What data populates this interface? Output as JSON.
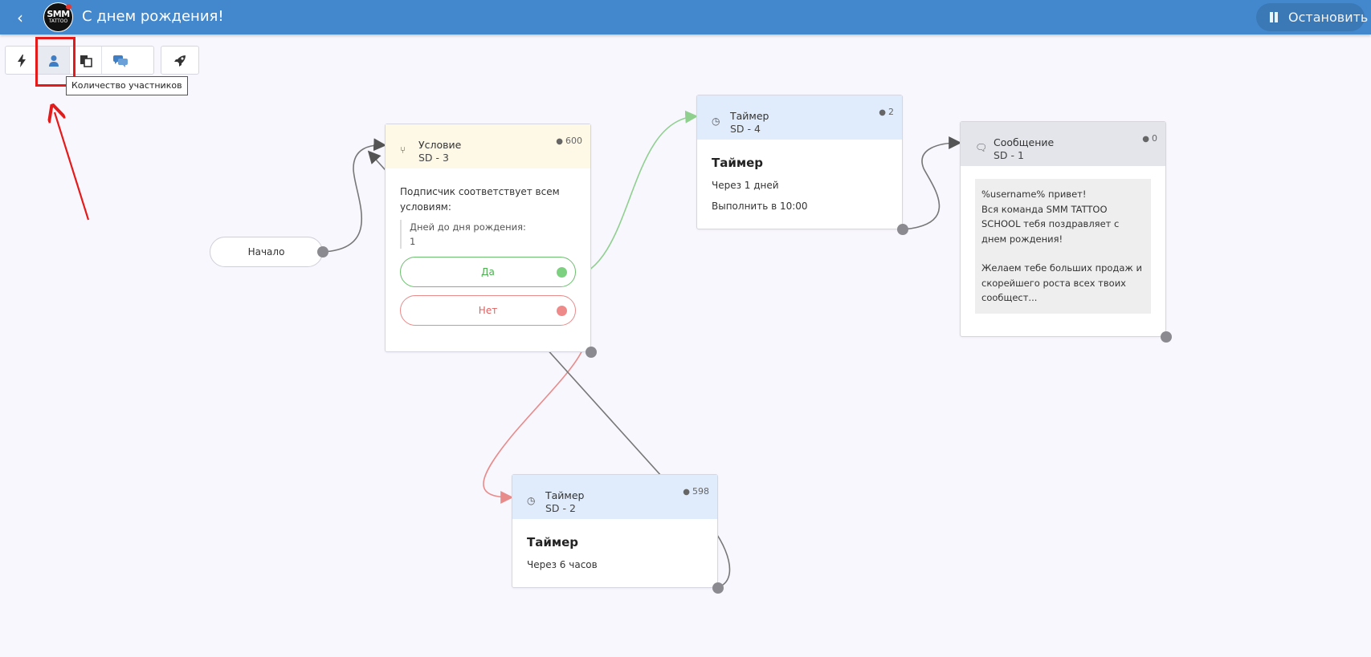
{
  "header": {
    "title": "С днем рождения!",
    "logo_text": "SMM",
    "logo_subtext": "TATTOO",
    "stop_label": "Остановить"
  },
  "toolbar": {
    "tooltip": "Количество участников"
  },
  "flow": {
    "start_label": "Начало",
    "condition_node": {
      "title": "Условие",
      "subtitle": "SD - 3",
      "count": "600",
      "description": "Подписчик соответствует всем условиям:",
      "rule_label": "Дней до дня рождения:",
      "rule_value": "1",
      "yes_label": "Да",
      "no_label": "Нет"
    },
    "timer_node_1": {
      "title": "Таймер",
      "subtitle": "SD - 4",
      "count": "2",
      "heading": "Таймер",
      "line1": "Через 1 дней",
      "line2": "Выполнить в 10:00"
    },
    "message_node": {
      "title": "Сообщение",
      "subtitle": "SD - 1",
      "count": "0",
      "lines": [
        "%username% привет!",
        "Вся команда SMM TATTOO SCHOOL тебя поздравляет с днем рождения!",
        "",
        "Желаем тебе больших продаж и скорейшего роста всех твоих сообщест..."
      ]
    },
    "timer_node_2": {
      "title": "Таймер",
      "subtitle": "SD - 2",
      "count": "598",
      "heading": "Таймер",
      "line1": "Через 6 часов"
    }
  },
  "colors": {
    "header": "#4388cc",
    "yes": "#4caf50",
    "no": "#e06060",
    "highlight": "#e41b1b"
  }
}
